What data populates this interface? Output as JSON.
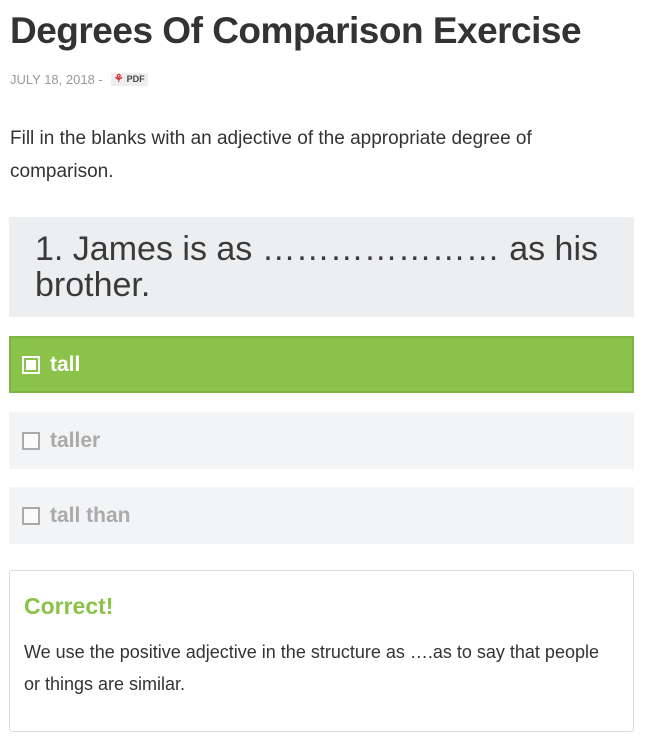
{
  "article": {
    "title": "Degrees Of Comparison Exercise",
    "date": "JULY 18, 2018 -",
    "pdf_label": "PDF"
  },
  "instructions": "Fill in the blanks with an adjective of the appropriate degree of comparison.",
  "question": {
    "text": "1. James is as ………………… as his brother."
  },
  "options": [
    {
      "label": "tall",
      "selected": true
    },
    {
      "label": "taller",
      "selected": false
    },
    {
      "label": "tall than",
      "selected": false
    }
  ],
  "feedback": {
    "title": "Correct!",
    "text": "We use the positive adjective in the structure as ….as to say that people or things are similar."
  },
  "colors": {
    "correct_green": "#8bc34a",
    "question_bg": "#eceef0",
    "option_bg": "#f3f4f5"
  },
  "icons": {
    "pdf": "pdf-icon",
    "checkbox": "checkbox-icon"
  }
}
